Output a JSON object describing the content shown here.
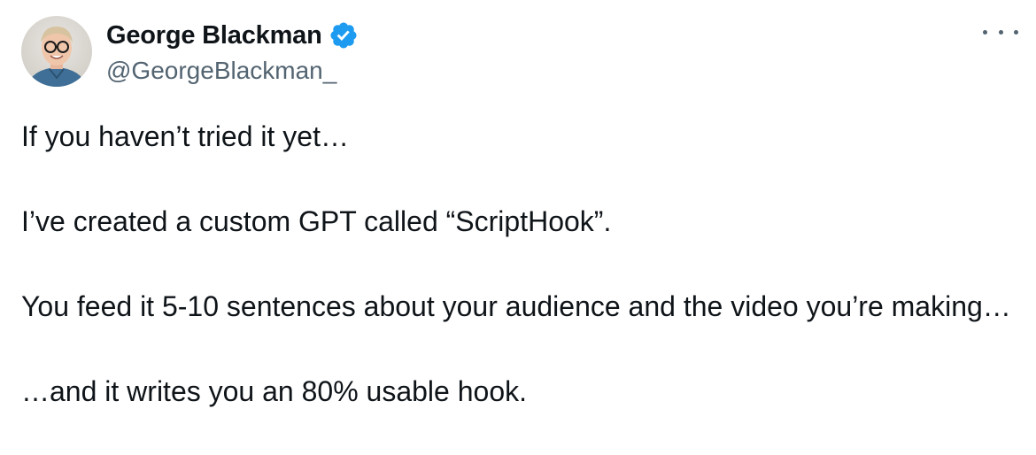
{
  "author": {
    "display_name": "George Blackman",
    "handle": "@GeorgeBlackman_",
    "verified_icon": "verified-badge-icon",
    "avatar_icon": "avatar-photo",
    "colors": {
      "verified": "#1d9bf0",
      "secondary_text": "#536471",
      "primary_text": "#0f1419"
    }
  },
  "more_menu": {
    "icon": "more-options-icon"
  },
  "tweet": {
    "paragraphs": [
      "If you haven’t tried it yet…",
      "I’ve created a custom GPT called “ScriptHook”.",
      "You feed it 5-10 sentences about your audience and the video you’re making…",
      "…and it writes you an 80% usable hook."
    ]
  }
}
